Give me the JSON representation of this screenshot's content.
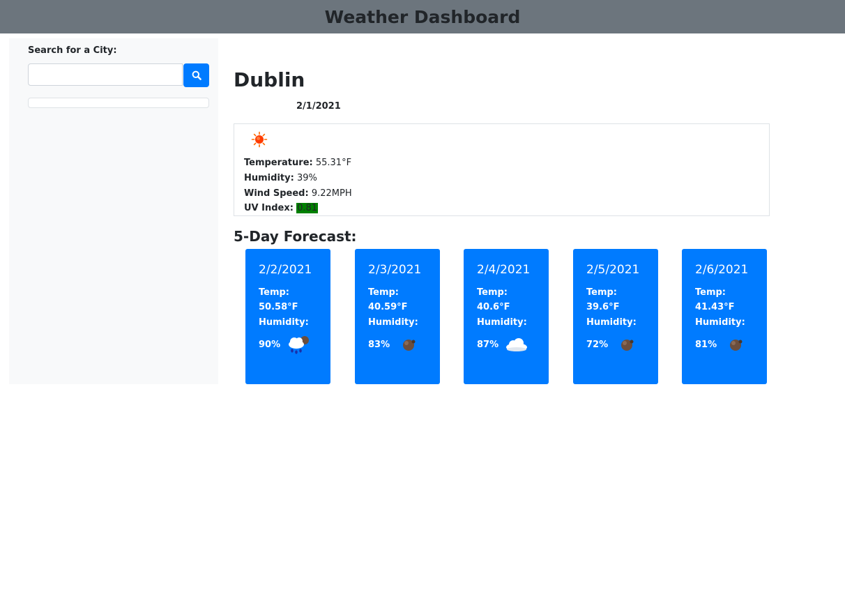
{
  "header": {
    "title": "Weather Dashboard"
  },
  "search": {
    "label": "Search for a City:",
    "value": "",
    "placeholder": "",
    "button_icon": "search-icon"
  },
  "current": {
    "city": "Dublin",
    "date": "2/1/2021",
    "icon": "sun-icon",
    "temperature_label": "Temperature:",
    "temperature": "55.31°F",
    "humidity_label": "Humidity:",
    "humidity": "39%",
    "wind_label": "Wind Speed:",
    "wind": "9.22MPH",
    "uv_label": "UV Index:",
    "uv": "0.81",
    "uv_color": "#008000"
  },
  "forecast": {
    "title": "5-Day Forecast:",
    "card_color": "#007bff",
    "days": [
      {
        "date": "2/2/2021",
        "temp_label": "Temp:",
        "temp": "50.58°F",
        "humidity_label": "Humidity:",
        "humidity": "90%",
        "icon": "rain-cloud-icon"
      },
      {
        "date": "2/3/2021",
        "temp_label": "Temp:",
        "temp": "40.59°F",
        "humidity_label": "Humidity:",
        "humidity": "83%",
        "icon": "moon-icon"
      },
      {
        "date": "2/4/2021",
        "temp_label": "Temp:",
        "temp": "40.6°F",
        "humidity_label": "Humidity:",
        "humidity": "87%",
        "icon": "cloud-icon"
      },
      {
        "date": "2/5/2021",
        "temp_label": "Temp:",
        "temp": "39.6°F",
        "humidity_label": "Humidity:",
        "humidity": "72%",
        "icon": "moon-icon"
      },
      {
        "date": "2/6/2021",
        "temp_label": "Temp:",
        "temp": "41.43°F",
        "humidity_label": "Humidity:",
        "humidity": "81%",
        "icon": "moon-icon"
      }
    ]
  }
}
